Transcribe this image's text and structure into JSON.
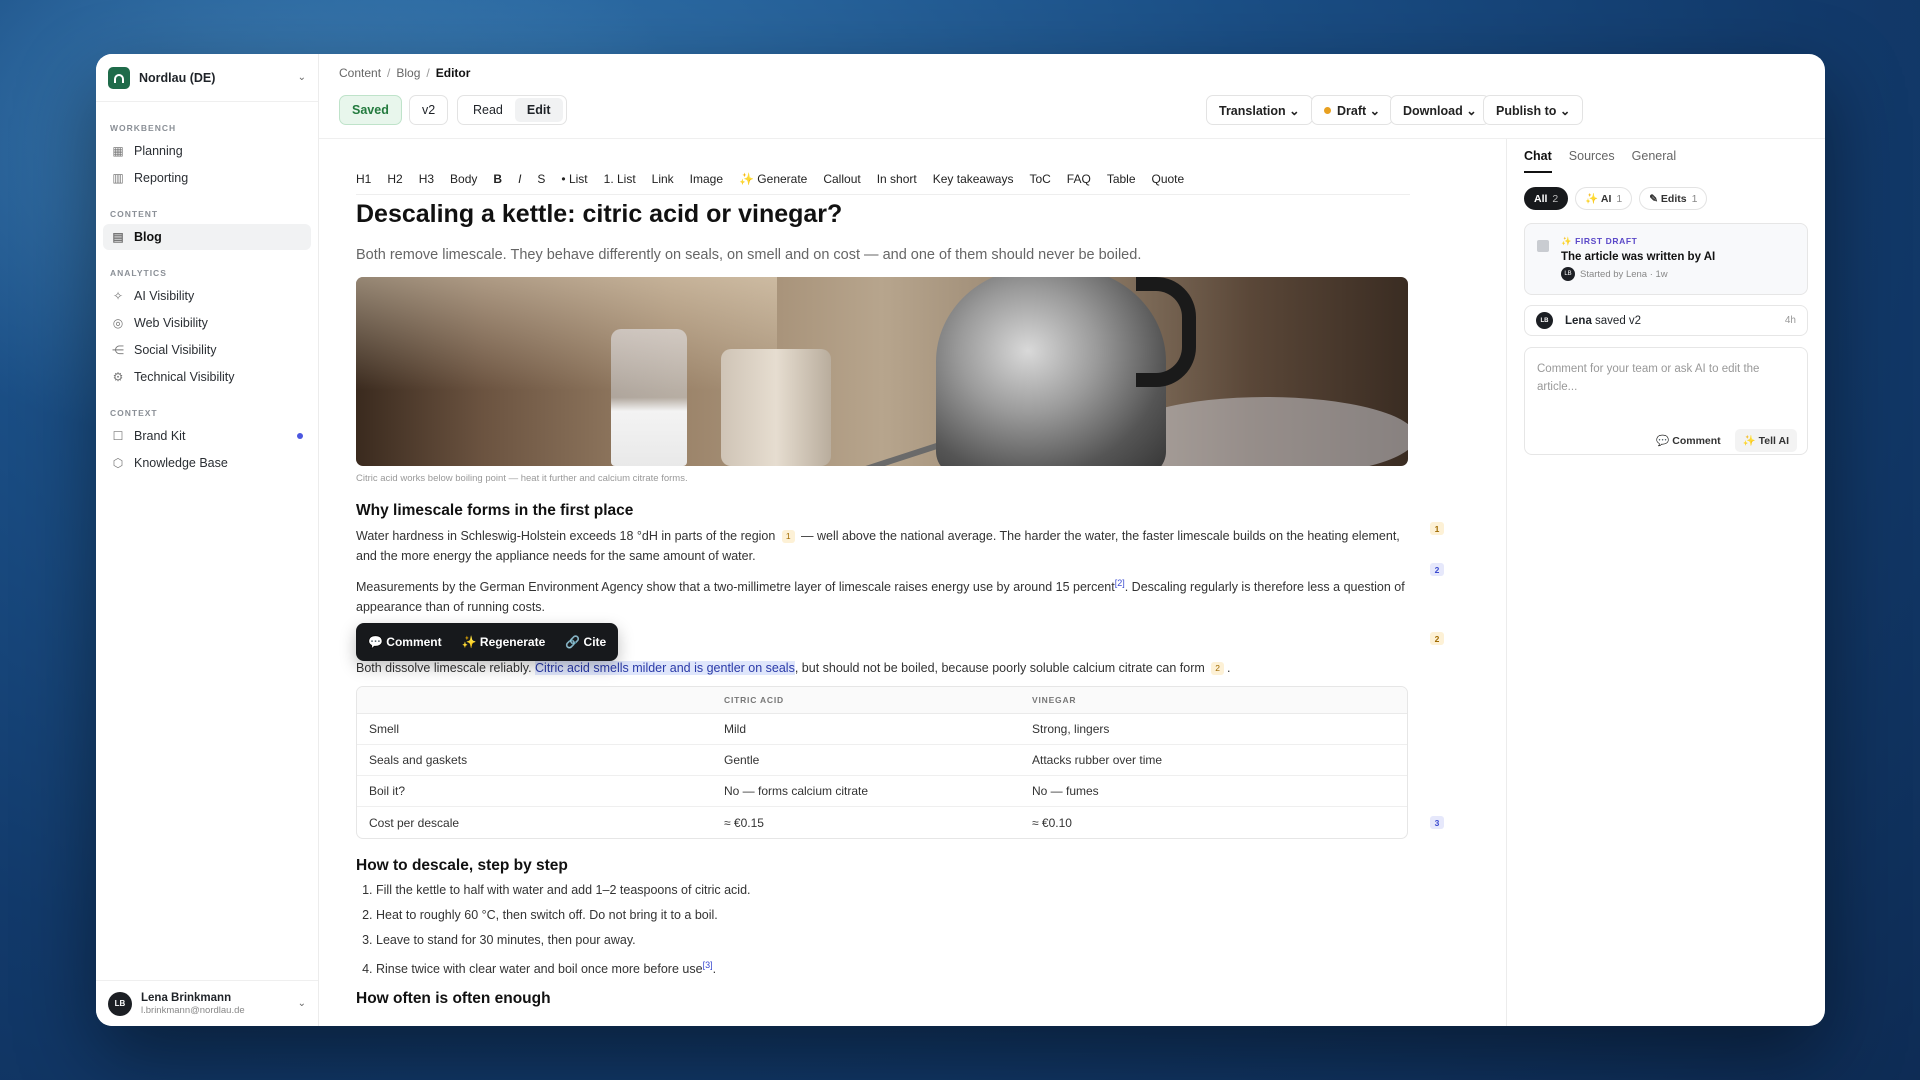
{
  "workspace": {
    "name": "Nordlau (DE)"
  },
  "sidebar": {
    "sections": [
      {
        "title": "WORKBENCH",
        "items": [
          {
            "label": "Planning",
            "icon": "calendar-icon"
          },
          {
            "label": "Reporting",
            "icon": "bar-chart-icon"
          }
        ]
      },
      {
        "title": "CONTENT",
        "items": [
          {
            "label": "Blog",
            "icon": "document-icon",
            "active": true
          }
        ]
      },
      {
        "title": "ANALYTICS",
        "items": [
          {
            "label": "AI Visibility",
            "icon": "sparkle-icon"
          },
          {
            "label": "Web Visibility",
            "icon": "globe-icon"
          },
          {
            "label": "Social Visibility",
            "icon": "share-icon"
          },
          {
            "label": "Technical Visibility",
            "icon": "code-icon"
          }
        ]
      },
      {
        "title": "CONTEXT",
        "items": [
          {
            "label": "Brand Kit",
            "icon": "book-icon"
          },
          {
            "label": "Knowledge Base",
            "icon": "cube-icon"
          }
        ]
      }
    ],
    "user": {
      "initials": "LB",
      "name": "Lena Brinkmann",
      "email": "l.brinkmann@nordlau.de"
    }
  },
  "breadcrumb": [
    "Content",
    "Blog",
    "Editor"
  ],
  "header": {
    "saved": "Saved",
    "version": "v2",
    "mode_read": "Read",
    "mode_edit": "Edit",
    "translation": "Translation ⌄",
    "status": "Draft ⌄",
    "download": "Download ⌄",
    "publish": "Publish to ⌄",
    "status_color": "#e8a020"
  },
  "toolbar": [
    "H1",
    "H2",
    "H3",
    "Body",
    "B",
    "I",
    "S",
    "• List",
    "1. List",
    "Link",
    "Image",
    "✨ Generate",
    "Callout",
    "In short",
    "Key takeaways",
    "ToC",
    "FAQ",
    "Table",
    "Quote"
  ],
  "article": {
    "title": "Descaling a kettle: citric acid or vinegar?",
    "subtitle": "Both remove limescale. They behave differently on seals, on smell and on cost — and one of them should never be boiled.",
    "caption": "Citric acid works below boiling point — heat it further and calcium citrate forms.",
    "h_why": "Why limescale forms in the first place",
    "p1_a": "Water hardness in Schleswig-Holstein exceeds 18 °dH in parts of the region",
    "p1_badge": "1",
    "p1_b": " — well above the national average. The harder the water, the faster limescale builds on the heating element, and the more energy the appliance needs for the same amount of water.",
    "p2_a": "Measurements by the German Environment Agency show that a two-millimetre layer of limescale raises energy use by around 15 percent",
    "p2_sup": "[2]",
    "p2_b": ". Descaling regularly is therefore less a question of appearance than of running costs.",
    "p3_a": "Both dissolve limescale reliably. ",
    "p3_hl": "Citric acid smells milder and is gentler on seals",
    "p3_b": ", but should not be boiled, because poorly soluble calcium citrate can form",
    "p3_badge": "2",
    "p3_c": ".",
    "table": {
      "headers": [
        "",
        "CITRIC ACID",
        "VINEGAR"
      ],
      "rows": [
        [
          "Smell",
          "Mild",
          "Strong, lingers"
        ],
        [
          "Seals and gaskets",
          "Gentle",
          "Attacks rubber over time"
        ],
        [
          "Boil it?",
          "No — forms calcium citrate",
          "No — fumes"
        ],
        [
          "Cost per descale",
          "≈ €0.15",
          "≈ €0.10"
        ]
      ]
    },
    "h_how": "How to descale, step by step",
    "steps": [
      "Fill the kettle to half with water and add 1–2 teaspoons of citric acid.",
      "Heat to roughly 60 °C, then switch off. Do not bring it to a boil.",
      "Leave to stand for 30 minutes, then pour away.",
      "Rinse twice with clear water and boil once more before use"
    ],
    "step4_sup": "[3]",
    "step4_end": ".",
    "h_often": "How often is often enough"
  },
  "floatbar": {
    "comment": "💬 Comment",
    "regenerate": "✨ Regenerate",
    "cite": "🔗 Cite"
  },
  "margin_badges": [
    "1",
    "2",
    "2",
    "3"
  ],
  "panel": {
    "tabs": [
      "Chat",
      "Sources",
      "General"
    ],
    "filters": [
      {
        "label": "All",
        "count": "2"
      },
      {
        "label": "✨ AI",
        "count": "1"
      },
      {
        "label": "✎ Edits",
        "count": "1"
      }
    ],
    "draft_tag": "✨ FIRST DRAFT",
    "draft_title": "The article was written by AI",
    "draft_meta": "Started by Lena · 1w",
    "activity_user": "Lena",
    "activity_text": " saved v2",
    "activity_time": "4h",
    "comment_placeholder": "Comment for your team or ask AI to edit the article...",
    "comment_btn": "💬 Comment",
    "tellai_btn": "✨ Tell AI"
  }
}
